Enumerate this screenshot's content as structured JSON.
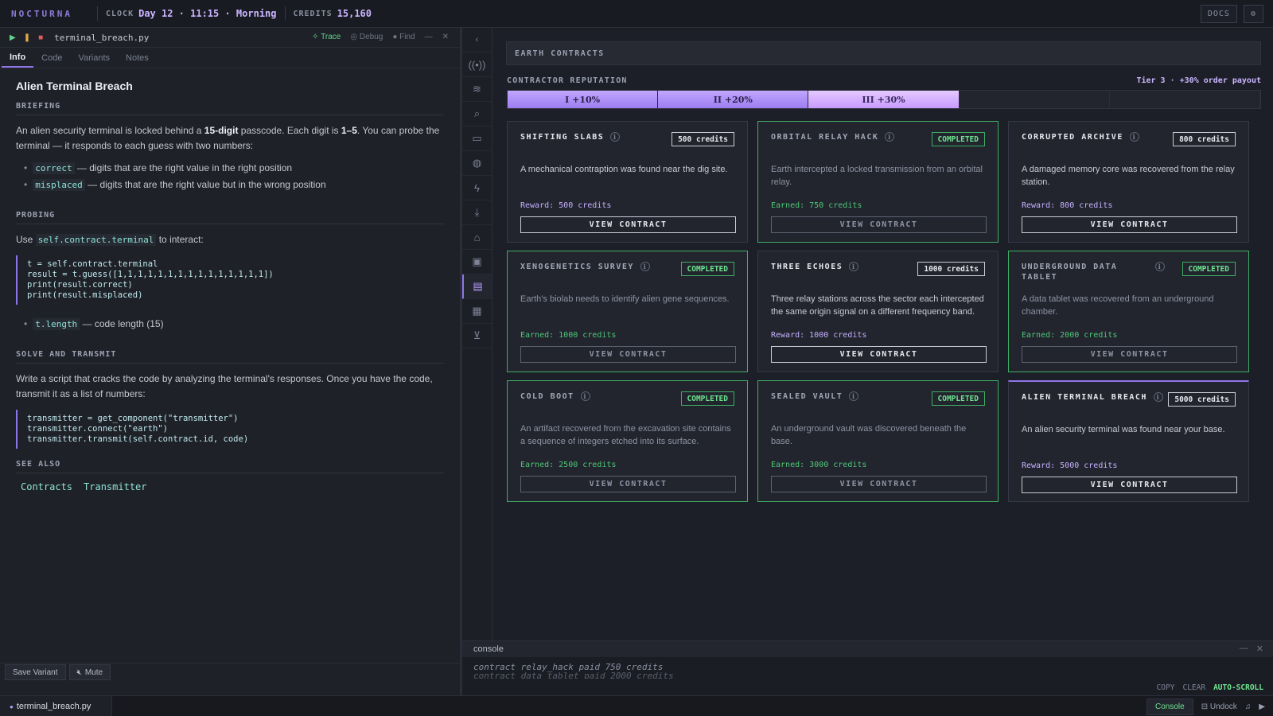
{
  "topbar": {
    "brand": "NOCTURNA",
    "clock_label": "CLOCK",
    "clock_value": "Day 12 · 11:15 · Morning",
    "credits_label": "CREDITS",
    "credits_value": "15,160",
    "docs_label": "DOCS",
    "settings_icon": "gear-icon"
  },
  "editor": {
    "filename": "terminal_breach.py",
    "tools": {
      "trace": "Trace",
      "debug": "Debug",
      "find": "Find"
    },
    "tabs": [
      "Info",
      "Code",
      "Variants",
      "Notes"
    ],
    "active_tab": "Info",
    "title": "Alien Terminal Breach",
    "sections": {
      "briefing": "BRIEFING",
      "probing": "PROBING",
      "solve": "SOLVE AND TRANSMIT",
      "see_also": "SEE ALSO"
    },
    "briefing": {
      "p_pre": "An alien security terminal is locked behind a ",
      "p_b1": "15-digit",
      "p_mid": " passcode. Each digit is ",
      "p_b2": "1–5",
      "p_post": ". You can probe the terminal — it responds to each guess with two numbers:",
      "b1_code": "correct",
      "b1_text": " — digits that are the right value in the right position",
      "b2_code": "misplaced",
      "b2_text": " — digits that are the right value but in the wrong position"
    },
    "probing": {
      "use": "Use ",
      "code": "self.contract.terminal",
      "after": " to interact:",
      "block": "t = self.contract.terminal\nresult = t.guess([1,1,1,1,1,1,1,1,1,1,1,1,1,1,1])\nprint(result.correct)\nprint(result.misplaced)",
      "b_code": "t.length",
      "b_text": " — code length (15)"
    },
    "solve": {
      "text": "Write a script that cracks the code by analyzing the terminal's responses. Once you have the code, transmit it as a list of numbers:",
      "block": "transmitter = get_component(\"transmitter\")\ntransmitter.connect(\"earth\")\ntransmitter.transmit(self.contract.id, code)"
    },
    "see_also": [
      "Contracts",
      "Transmitter"
    ],
    "save_variant": "Save Variant",
    "mute": "Mute"
  },
  "rail_icons": [
    "broadcast-icon",
    "signal-icon",
    "zoom-icon",
    "monitor-icon",
    "globe-icon",
    "bolt-icon",
    "download-icon",
    "factory-icon",
    "crate-icon",
    "document-icon",
    "briefcase-icon",
    "cart-icon"
  ],
  "contracts": {
    "header": "EARTH CONTRACTS",
    "reputation_label": "CONTRACTOR REPUTATION",
    "reputation_status": "Tier 3 · +30% order payout",
    "tiers": [
      {
        "label": "I +10%",
        "state": "done"
      },
      {
        "label": "II +20%",
        "state": "done"
      },
      {
        "label": "III +30%",
        "state": "current"
      },
      {
        "label": "",
        "state": "empty"
      },
      {
        "label": "",
        "state": "empty"
      }
    ],
    "view_label": "VIEW CONTRACT",
    "cards": [
      {
        "title": "SHIFTING SLABS",
        "badge": "500 credits",
        "completed": false,
        "desc": "A mechanical contraption was found near the dig site.",
        "reward": "Reward: 500 credits"
      },
      {
        "title": "ORBITAL RELAY HACK",
        "badge": "COMPLETED",
        "completed": true,
        "desc": "Earth intercepted a locked transmission from an orbital relay.",
        "reward": "Earned: 750 credits"
      },
      {
        "title": "CORRUPTED ARCHIVE",
        "badge": "800 credits",
        "completed": false,
        "desc": "A damaged memory core was recovered from the relay station.",
        "reward": "Reward: 800 credits"
      },
      {
        "title": "XENOGENETICS SURVEY",
        "badge": "COMPLETED",
        "completed": true,
        "desc": "Earth's biolab needs to identify alien gene sequences.",
        "reward": "Earned: 1000 credits"
      },
      {
        "title": "THREE ECHOES",
        "badge": "1000 credits",
        "completed": false,
        "desc": "Three relay stations across the sector each intercepted the same origin signal on a different frequency band.",
        "reward": "Reward: 1000 credits"
      },
      {
        "title": "UNDERGROUND DATA TABLET",
        "badge": "COMPLETED",
        "completed": true,
        "desc": "A data tablet was recovered from an underground chamber.",
        "reward": "Earned: 2000 credits"
      },
      {
        "title": "COLD BOOT",
        "badge": "COMPLETED",
        "completed": true,
        "desc": "An artifact recovered from the excavation site contains a sequence of integers etched into its surface.",
        "reward": "Earned: 2500 credits"
      },
      {
        "title": "SEALED VAULT",
        "badge": "COMPLETED",
        "completed": true,
        "desc": "An underground vault was discovered beneath the base.",
        "reward": "Earned: 3000 credits"
      },
      {
        "title": "ALIEN TERMINAL BREACH",
        "badge": "5000 credits",
        "completed": false,
        "desc": "An alien security terminal was found near your base.",
        "reward": "Reward: 5000 credits"
      }
    ]
  },
  "console": {
    "title": "console",
    "line1": "contract relay_hack paid 750 credits",
    "line2": "contract data_tablet paid 2000 credits",
    "copy": "COPY",
    "clear": "CLEAR",
    "autoscroll": "AUTO-SCROLL"
  },
  "statusbar": {
    "file_tab": "terminal_breach.py",
    "console": "Console",
    "undock": "Undock"
  }
}
